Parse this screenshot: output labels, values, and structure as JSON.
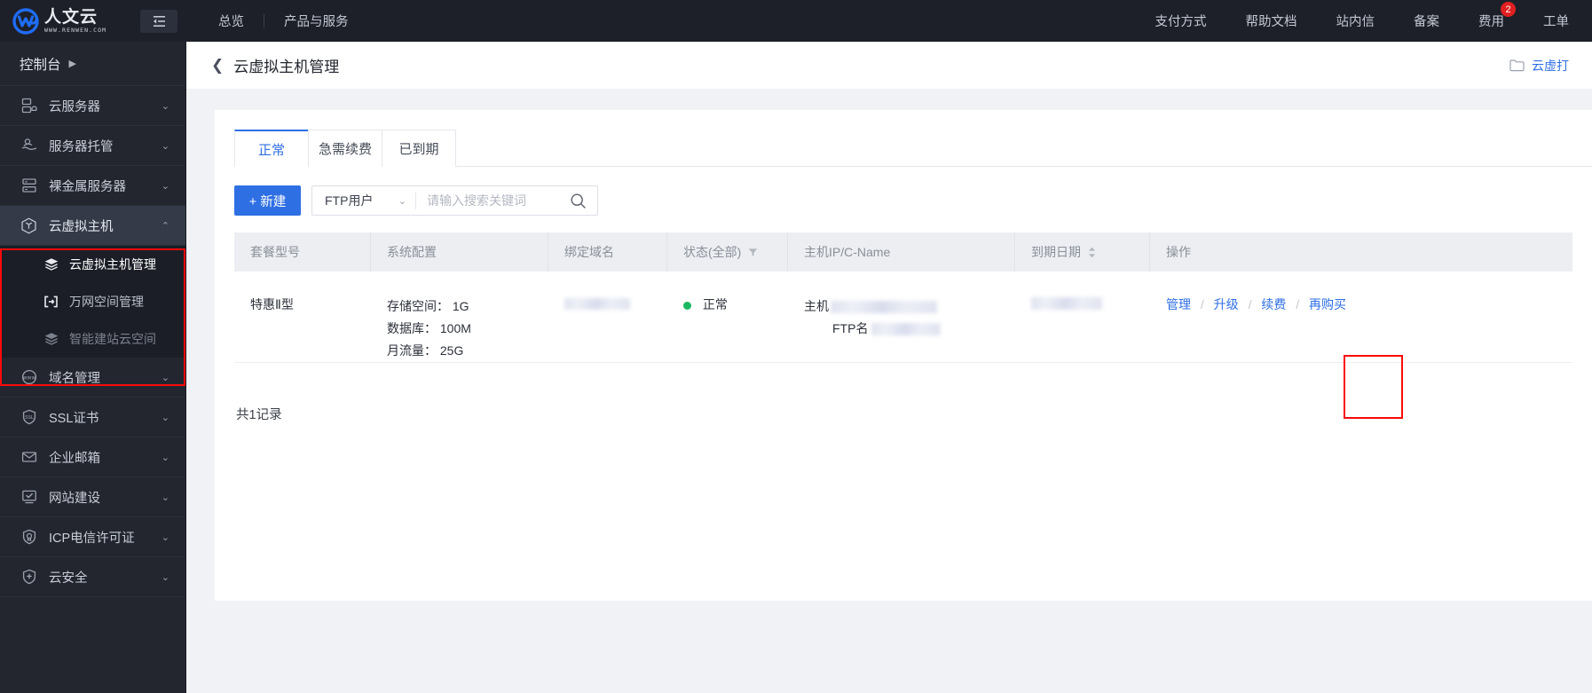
{
  "topbar": {
    "logo_cn": "人文云",
    "logo_url": "WWW.RENWEN.COM",
    "collapse_icon": "collapse-menu-icon",
    "nav_left": [
      {
        "label": "总览"
      },
      {
        "label": "产品与服务"
      }
    ],
    "nav_right": [
      {
        "label": "支付方式",
        "badge": ""
      },
      {
        "label": "帮助文档",
        "badge": ""
      },
      {
        "label": "站内信",
        "badge": ""
      },
      {
        "label": "备案",
        "badge": ""
      },
      {
        "label": "费用",
        "badge": "2"
      },
      {
        "label": "工单",
        "badge": ""
      }
    ],
    "badge_color": "#e02020"
  },
  "sidebar": {
    "console_label": "控制台",
    "console_caret": "▶",
    "items": [
      {
        "label": "云服务器",
        "icon": "server-icon",
        "chevron": "⌄",
        "active": false
      },
      {
        "label": "服务器托管",
        "icon": "hosting-icon",
        "chevron": "⌄",
        "active": false
      },
      {
        "label": "裸金属服务器",
        "icon": "bare-metal-icon",
        "chevron": "⌄",
        "active": false
      },
      {
        "label": "云虚拟主机",
        "icon": "cube-icon",
        "chevron": "⌃",
        "active": true
      },
      {
        "label": "域名管理",
        "icon": "www-icon",
        "chevron": "⌄",
        "active": false
      },
      {
        "label": "SSL证书",
        "icon": "ssl-shield-icon",
        "chevron": "⌄",
        "active": false
      },
      {
        "label": "企业邮箱",
        "icon": "mail-icon",
        "chevron": "⌄",
        "active": false
      },
      {
        "label": "网站建设",
        "icon": "monitor-check-icon",
        "chevron": "⌄",
        "active": false
      },
      {
        "label": "ICP电信许可证",
        "icon": "license-shield-icon",
        "chevron": "⌄",
        "active": false
      },
      {
        "label": "云安全",
        "icon": "security-shield-icon",
        "chevron": "⌄",
        "active": false
      }
    ],
    "subitems": [
      {
        "label": "云虚拟主机管理",
        "icon": "layers-icon",
        "state": "current"
      },
      {
        "label": "万网空间管理",
        "icon": "brackets-icon",
        "state": "normal"
      },
      {
        "label": "智能建站云空间",
        "icon": "layers-icon",
        "state": "dim"
      }
    ],
    "highlight_color": "#fb0a0a"
  },
  "page": {
    "back_icon": "chevron-left-icon",
    "title": "云虚拟主机管理",
    "head_right_icon": "folder-icon",
    "head_right_label": "云虚打"
  },
  "tabs": [
    {
      "label": "正常",
      "active": true
    },
    {
      "label": "急需续费",
      "active": false
    },
    {
      "label": "已到期",
      "active": false
    }
  ],
  "toolbar": {
    "new_label": "+ 新建",
    "select_value": "FTP用户",
    "select_chevron": "⌄",
    "search_placeholder": "请输入搜索关键词",
    "search_value": "",
    "search_icon": "search-icon"
  },
  "table": {
    "columns": [
      {
        "label": "套餐型号",
        "icon": ""
      },
      {
        "label": "系统配置",
        "icon": ""
      },
      {
        "label": "绑定域名",
        "icon": ""
      },
      {
        "label": "状态(全部)",
        "icon": "filter-icon"
      },
      {
        "label": "主机IP/C-Name",
        "icon": ""
      },
      {
        "label": "到期日期",
        "icon": "sort-icon"
      },
      {
        "label": "操作",
        "icon": ""
      }
    ],
    "rows": [
      {
        "plan": "特惠Ⅱ型",
        "config": [
          "存储空间： 1G",
          "数据库： 100M",
          "月流量： 25G"
        ],
        "domain_redacted": true,
        "status_text": "正常",
        "status_color": "#19b861",
        "ip_label": "主机",
        "ftp_label": "FTP名",
        "ip_redacted": true,
        "expire_redacted": true,
        "operations": [
          {
            "label": "管理",
            "highlighted": true
          },
          {
            "label": "升级",
            "highlighted": false
          },
          {
            "label": "续费",
            "highlighted": false
          },
          {
            "label": "再购买",
            "highlighted": false
          }
        ],
        "op_separator": "/"
      }
    ],
    "total_label": "共1记录"
  },
  "colors": {
    "primary": "#2f6fe4",
    "topbar_bg": "#1d2029",
    "sidebar_bg": "#23262f",
    "canvas_bg": "#f0f2f5"
  }
}
